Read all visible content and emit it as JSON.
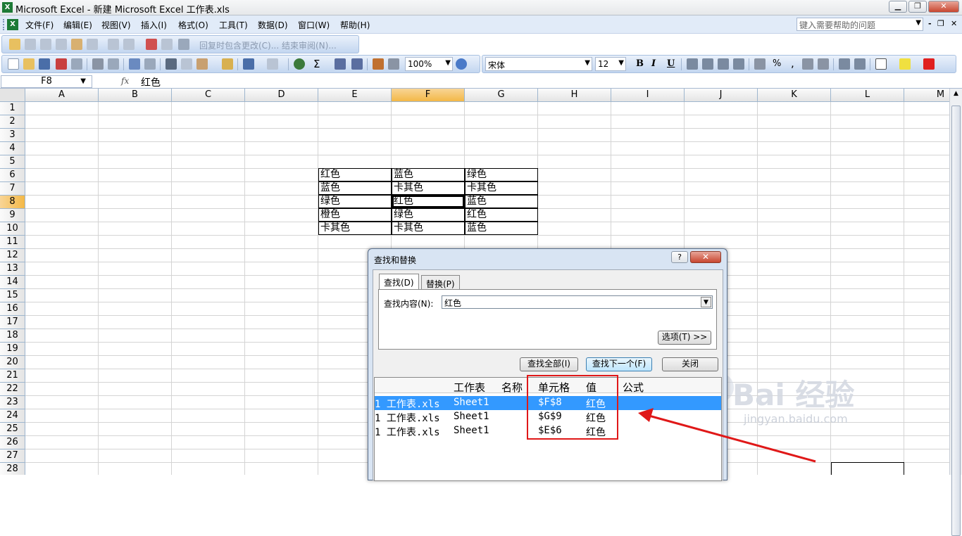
{
  "window": {
    "title": "Microsoft Excel - 新建 Microsoft Excel 工作表.xls",
    "app_icon_glyph": "X"
  },
  "menu": {
    "items": [
      "文件(F)",
      "编辑(E)",
      "视图(V)",
      "插入(I)",
      "格式(O)",
      "工具(T)",
      "数据(D)",
      "窗口(W)",
      "帮助(H)"
    ],
    "help_placeholder": "键入需要帮助的问题"
  },
  "toolbar": {
    "review_text": "回复时包含更改(C)...  结束审阅(N)...",
    "zoom": "100%",
    "font": "宋体",
    "font_size": "12",
    "bold": "B",
    "italic": "I",
    "underline": "U",
    "sigma": "Σ",
    "percent": "%",
    "comma": ","
  },
  "formula_bar": {
    "name_box": "F8",
    "fx": "fx",
    "value": "红色"
  },
  "grid": {
    "columns": [
      "A",
      "B",
      "C",
      "D",
      "E",
      "F",
      "G",
      "H",
      "I",
      "J",
      "K",
      "L",
      "M"
    ],
    "rows": [
      "1",
      "2",
      "3",
      "4",
      "5",
      "6",
      "7",
      "8",
      "9",
      "10",
      "11",
      "12",
      "13",
      "14",
      "15",
      "16",
      "17",
      "18",
      "19",
      "20",
      "21",
      "22",
      "23",
      "24",
      "25",
      "26",
      "27",
      "28"
    ],
    "selected_column": "F",
    "selected_row": "8",
    "data": [
      [
        "红色",
        "蓝色",
        "绿色"
      ],
      [
        "蓝色",
        "卡其色",
        "卡其色"
      ],
      [
        "绿色",
        "红色",
        "蓝色"
      ],
      [
        "橙色",
        "绿色",
        "红色"
      ],
      [
        "卡其色",
        "卡其色",
        "蓝色"
      ]
    ]
  },
  "dialog": {
    "title": "查找和替换",
    "help_glyph": "?",
    "close_glyph": "✕",
    "tabs": [
      "查找(D)",
      "替换(P)"
    ],
    "find_label": "查找内容(N):",
    "find_value": "红色",
    "options_button": "选项(T) >>",
    "find_all_button": "查找全部(I)",
    "find_next_button": "查找下一个(F)",
    "close_button": "关闭",
    "result_headers": [
      "工作表",
      "名称",
      "单元格",
      "值",
      "公式"
    ],
    "results": [
      {
        "book": "1 工作表.xls",
        "sheet": "Sheet1",
        "cell": "$F$8",
        "value": "红色"
      },
      {
        "book": "1 工作表.xls",
        "sheet": "Sheet1",
        "cell": "$G$9",
        "value": "红色"
      },
      {
        "book": "1 工作表.xls",
        "sheet": "Sheet1",
        "cell": "$E$6",
        "value": "红色"
      }
    ]
  },
  "watermark": {
    "brand": "Bai 经验",
    "url": "jingyan.baidu.com"
  },
  "colors": {
    "selected_header": "#f3b847",
    "selection_row": "#3399ff",
    "annotation_red": "#e01818"
  }
}
